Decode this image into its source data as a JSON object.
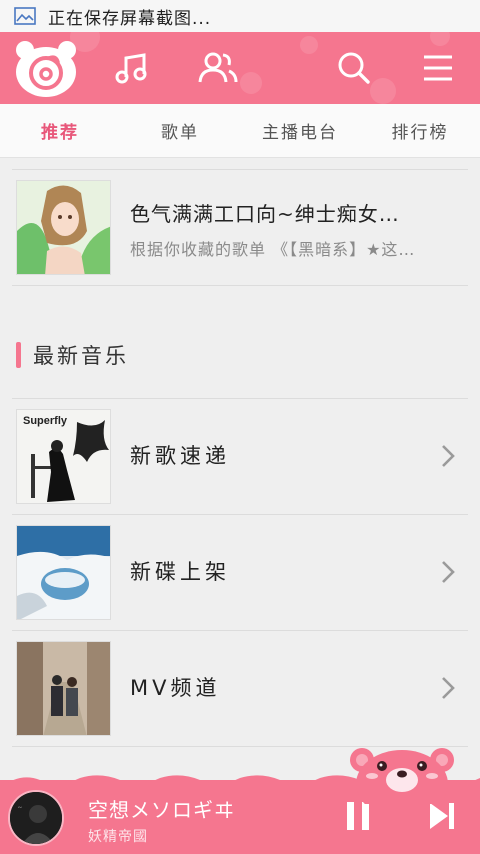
{
  "status_bar": {
    "text": "正在保存屏幕截图..."
  },
  "header": {
    "colors": {
      "primary": "#f5768f",
      "accent": "#e8577a"
    },
    "icons": [
      "app-logo-icon",
      "music-note-icon",
      "friends-icon",
      "search-icon",
      "menu-icon"
    ]
  },
  "tabs": [
    {
      "label": "推荐",
      "active": true
    },
    {
      "label": "歌单",
      "active": false
    },
    {
      "label": "主播电台",
      "active": false
    },
    {
      "label": "排行榜",
      "active": false
    }
  ],
  "playlist": {
    "title": "色气满满工口向~绅士痴女…",
    "subtitle": "根据你收藏的歌单 《【黑暗系】★这…"
  },
  "section": {
    "title": "最新音乐"
  },
  "rows": [
    {
      "label": "新歌速递",
      "cover_text": "Superfly"
    },
    {
      "label": "新碟上架"
    },
    {
      "label": "MV频道"
    }
  ],
  "player": {
    "song": "空想メソロギヰ",
    "artist": "妖精帝國"
  }
}
